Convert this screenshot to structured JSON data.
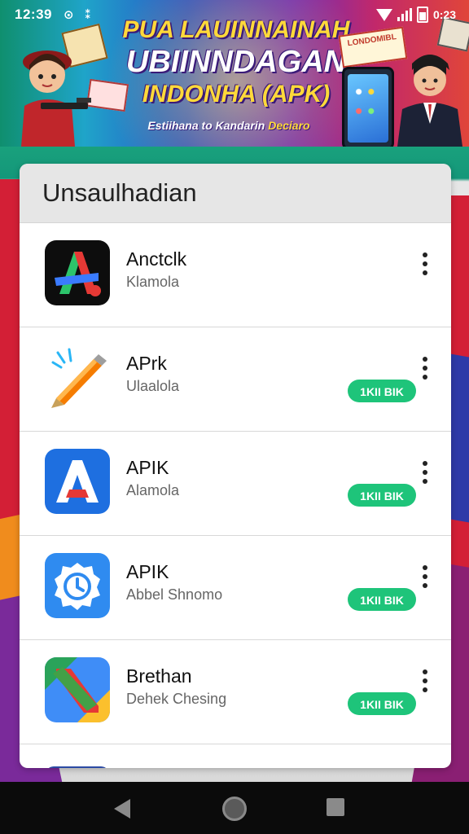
{
  "status_bar": {
    "time": "12:39",
    "battery_text": "0:23"
  },
  "banner": {
    "title_line1": "PUA LAUINNAINAH",
    "title_line2": "UBIINNDAGAN",
    "title_line3": "INDONHA (APK)",
    "subtitle_main": "Estiihana to Kandarin",
    "subtitle_highlight": "Deciaro",
    "tag_text": "LONDOMIBL"
  },
  "card": {
    "header_title": "Unsaulhadian",
    "apps": [
      {
        "name": "Anctclk",
        "subtitle": "Klamola",
        "button": "",
        "icon": "letter-a-black-icon"
      },
      {
        "name": "APrk",
        "subtitle": "Ulaalola",
        "button": "1KII BIK",
        "icon": "pencil-apk-icon"
      },
      {
        "name": "APIK",
        "subtitle": "Alamola",
        "button": "1KII BIK",
        "icon": "letter-a-blue-icon"
      },
      {
        "name": "APIK",
        "subtitle": "Abbel Shnomo",
        "button": "1KII BIK",
        "icon": "clock-badge-icon"
      },
      {
        "name": "Brethan",
        "subtitle": "Dehek Chesing",
        "button": "1KII BIK",
        "icon": "colorful-n-icon"
      }
    ]
  },
  "colors": {
    "accent_green": "#1ec47a",
    "header_gray": "#e6e6e6"
  }
}
